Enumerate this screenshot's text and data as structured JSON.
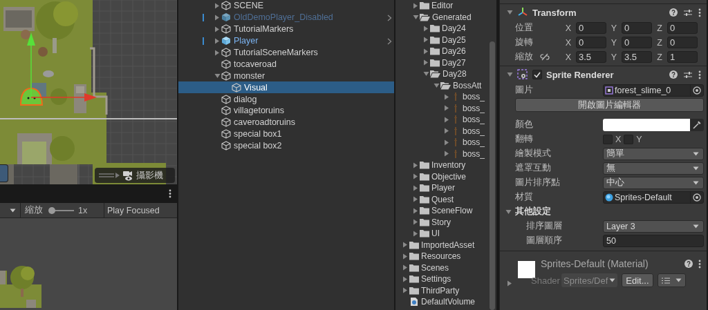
{
  "scene_view": {
    "overlay": {
      "label": "攝影機"
    }
  },
  "game_toolbar": {
    "zoom": {
      "label": "縮放",
      "level": 0.05,
      "reading": "1x"
    },
    "play_mode": {
      "value": "Play Focused"
    }
  },
  "hierarchy": {
    "items": [
      {
        "name": "SCENE",
        "kind": "object",
        "disabled": false,
        "selected": false,
        "expanded": false
      },
      {
        "name": "OldDemoPlayer_Disabled",
        "kind": "prefab",
        "disabled": true,
        "selected": false,
        "expanded": false
      },
      {
        "name": "TutorialMarkers",
        "kind": "object",
        "disabled": false,
        "selected": false,
        "expanded": false
      },
      {
        "name": "Player",
        "kind": "prefab",
        "disabled": false,
        "selected": false,
        "expanded": false
      },
      {
        "name": "TutorialSceneMarkers",
        "kind": "object",
        "disabled": false,
        "selected": false,
        "expanded": false
      },
      {
        "name": "tocaveroad",
        "kind": "object",
        "disabled": false,
        "selected": false
      },
      {
        "name": "monster",
        "kind": "object",
        "disabled": false,
        "selected": false,
        "expanded": true,
        "children": [
          {
            "name": "Visual",
            "kind": "object",
            "disabled": false,
            "selected": true
          }
        ]
      },
      {
        "name": "dialog",
        "kind": "object",
        "disabled": false,
        "selected": false
      },
      {
        "name": "villagetoruins",
        "kind": "object",
        "disabled": false,
        "selected": false
      },
      {
        "name": "caveroadtoruins",
        "kind": "object",
        "disabled": false,
        "selected": false
      },
      {
        "name": "special box1",
        "kind": "object",
        "disabled": false,
        "selected": false
      },
      {
        "name": "special box2",
        "kind": "object",
        "disabled": false,
        "selected": false
      }
    ]
  },
  "project": {
    "nested_items": [
      {
        "name": "Editor",
        "kind": "folder",
        "expanded": false
      },
      {
        "name": "Generated",
        "kind": "folder",
        "expanded": true,
        "children": [
          {
            "name": "Day24",
            "kind": "folder",
            "expanded": false
          },
          {
            "name": "Day25",
            "kind": "folder",
            "expanded": false
          },
          {
            "name": "Day26",
            "kind": "folder",
            "expanded": false
          },
          {
            "name": "Day27",
            "kind": "folder",
            "expanded": false
          },
          {
            "name": "Day28",
            "kind": "folder",
            "expanded": true,
            "children": [
              {
                "name": "BossAtt",
                "kind": "folder",
                "expanded": true,
                "children": [
                  {
                    "name": "boss_",
                    "kind": "sprite",
                    "expanded": false
                  },
                  {
                    "name": "boss_",
                    "kind": "sprite",
                    "expanded": false
                  },
                  {
                    "name": "boss_",
                    "kind": "sprite",
                    "expanded": false
                  },
                  {
                    "name": "boss_",
                    "kind": "sprite",
                    "expanded": false
                  },
                  {
                    "name": "boss_",
                    "kind": "sprite",
                    "expanded": false
                  },
                  {
                    "name": "boss_",
                    "kind": "sprite",
                    "expanded": false
                  }
                ]
              }
            ]
          }
        ]
      },
      {
        "name": "Inventory",
        "kind": "folder",
        "expanded": false
      },
      {
        "name": "Objective",
        "kind": "folder",
        "expanded": false
      },
      {
        "name": "Player",
        "kind": "folder",
        "expanded": false
      },
      {
        "name": "Quest",
        "kind": "folder",
        "expanded": false
      },
      {
        "name": "SceneFlow",
        "kind": "folder",
        "expanded": false
      },
      {
        "name": "Story",
        "kind": "folder",
        "expanded": false
      },
      {
        "name": "UI",
        "kind": "folder",
        "expanded": false
      }
    ],
    "items": [
      {
        "name": "ImportedAsset",
        "kind": "folder",
        "expanded": false
      },
      {
        "name": "Resources",
        "kind": "folder",
        "expanded": false
      },
      {
        "name": "Scenes",
        "kind": "folder",
        "expanded": false
      },
      {
        "name": "Settings",
        "kind": "folder",
        "expanded": false
      },
      {
        "name": "ThirdParty",
        "kind": "folder",
        "expanded": false
      },
      {
        "name": "DefaultVolume",
        "kind": "asset"
      }
    ]
  },
  "inspector": {
    "transform": {
      "title": "Transform",
      "expanded": true,
      "rows": [
        {
          "label": "位置",
          "fields": [
            {
              "axis": "X",
              "value": "0"
            },
            {
              "axis": "Y",
              "value": "0"
            },
            {
              "axis": "Z",
              "value": "0"
            }
          ]
        },
        {
          "label": "旋轉",
          "fields": [
            {
              "axis": "X",
              "value": "0"
            },
            {
              "axis": "Y",
              "value": "0"
            },
            {
              "axis": "Z",
              "value": "0"
            }
          ]
        },
        {
          "label": "縮放",
          "linked": false,
          "fields": [
            {
              "axis": "X",
              "value": "3.5"
            },
            {
              "axis": "Y",
              "value": "3.5"
            },
            {
              "axis": "Z",
              "value": "1"
            }
          ]
        }
      ]
    },
    "sprite_renderer": {
      "title": "Sprite Renderer",
      "enabled": true,
      "expanded": true,
      "properties": [
        {
          "kind": "sprite",
          "label": "圖片",
          "value": "forest_slime_0"
        },
        {
          "kind": "button",
          "label": "開啟圖片編輯器"
        },
        {
          "kind": "color",
          "label": "顏色",
          "color": "#ffffff"
        },
        {
          "kind": "flip",
          "label": "翻轉",
          "options": [
            {
              "label": "X",
              "checked": false
            },
            {
              "label": "Y",
              "checked": false
            }
          ]
        },
        {
          "kind": "dropdown",
          "label": "繪製模式",
          "value": "簡單"
        },
        {
          "kind": "dropdown",
          "label": "遮罩互動",
          "value": "無"
        },
        {
          "kind": "dropdown",
          "label": "圖片排序點",
          "value": "中心"
        },
        {
          "kind": "material",
          "label": "材質",
          "value": "Sprites-Default"
        },
        {
          "kind": "foldout",
          "label": "其他設定",
          "expanded": true,
          "children": [
            {
              "kind": "dropdown",
              "label": "排序圖層",
              "value": "Layer 3"
            },
            {
              "kind": "number",
              "label": "圖層順序",
              "value": "50"
            }
          ]
        }
      ]
    },
    "material": {
      "title": "Sprites-Default (Material)",
      "expanded": false,
      "shader_label": "Shader",
      "shader": "Sprites/Def",
      "edit_button": "Edit..."
    }
  }
}
